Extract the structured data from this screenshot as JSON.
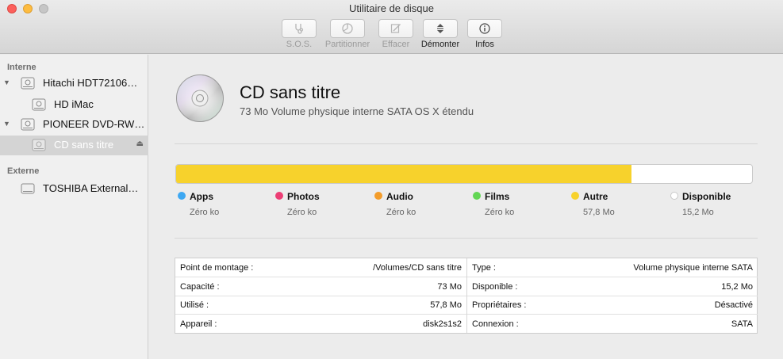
{
  "window": {
    "title": "Utilitaire de disque"
  },
  "toolbar": {
    "items": [
      {
        "label": "S.O.S.",
        "icon": "stethoscope-icon",
        "enabled": false
      },
      {
        "label": "Partitionner",
        "icon": "partition-icon",
        "enabled": false
      },
      {
        "label": "Effacer",
        "icon": "erase-icon",
        "enabled": false
      },
      {
        "label": "Démonter",
        "icon": "unmount-icon",
        "enabled": true
      },
      {
        "label": "Infos",
        "icon": "info-icon",
        "enabled": true
      }
    ]
  },
  "sidebar": {
    "internal_header": "Interne",
    "external_header": "Externe",
    "items": [
      {
        "label": "Hitachi HDT72106…",
        "icon": "internal-disk-icon"
      },
      {
        "label": "HD iMac",
        "icon": "volume-icon"
      },
      {
        "label": "PIONEER DVD-RW…",
        "icon": "optical-drive-icon"
      },
      {
        "label": "CD sans titre",
        "icon": "volume-icon",
        "selected": true
      },
      {
        "label": "TOSHIBA External…",
        "icon": "external-disk-icon"
      }
    ]
  },
  "volume": {
    "title": "CD sans titre",
    "subtitle": "73 Mo Volume physique interne SATA OS X étendu",
    "used_fraction": 0.79
  },
  "legend": [
    {
      "name": "Apps",
      "value": "Zéro ko",
      "color": "#3ea8f2"
    },
    {
      "name": "Photos",
      "value": "Zéro ko",
      "color": "#ec3e75"
    },
    {
      "name": "Audio",
      "value": "Zéro ko",
      "color": "#f39c2a"
    },
    {
      "name": "Films",
      "value": "Zéro ko",
      "color": "#62d654"
    },
    {
      "name": "Autre",
      "value": "57,8 Mo",
      "color": "#f7d22c"
    },
    {
      "name": "Disponible",
      "value": "15,2 Mo",
      "color": "#ffffff"
    }
  ],
  "info": {
    "left": [
      {
        "key": "Point de montage :",
        "value": "/Volumes/CD sans titre"
      },
      {
        "key": "Capacité :",
        "value": "73 Mo"
      },
      {
        "key": "Utilisé :",
        "value": "57,8 Mo"
      },
      {
        "key": "Appareil :",
        "value": "disk2s1s2"
      }
    ],
    "right": [
      {
        "key": "Type :",
        "value": "Volume physique interne SATA"
      },
      {
        "key": "Disponible :",
        "value": "15,2 Mo"
      },
      {
        "key": "Propriétaires :",
        "value": "Désactivé"
      },
      {
        "key": "Connexion :",
        "value": "SATA"
      }
    ]
  }
}
